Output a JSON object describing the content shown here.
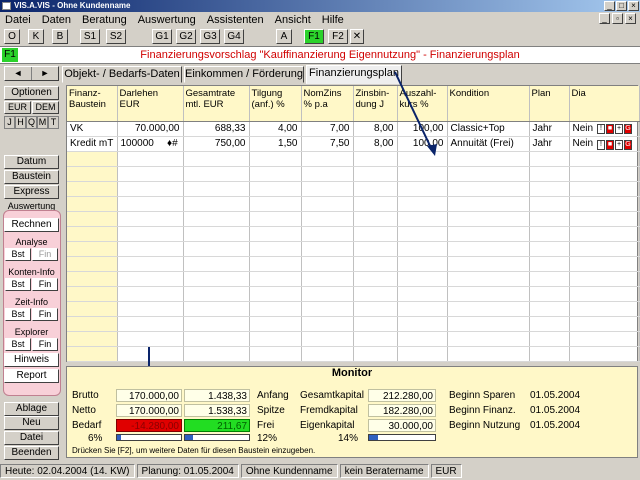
{
  "window": {
    "title": "VIS.A.VIS - Ohne Kundenname"
  },
  "menu": [
    "Datei",
    "Daten",
    "Beratung",
    "Auswertung",
    "Assistenten",
    "Ansicht",
    "Hilfe"
  ],
  "toolbar": {
    "o": "O",
    "k": "K",
    "b": "B",
    "s1": "S1",
    "s2": "S2",
    "g1": "G1",
    "g2": "G2",
    "g3": "G3",
    "g4": "G4",
    "a": "A",
    "f1": "F1",
    "f2": "F2",
    "x": "✕"
  },
  "info": {
    "badge": "F1",
    "text": "Finanzierungsvorschlag \"Kauffinanzierung Eigennutzung\" - Finanzierungsplan"
  },
  "sidebar": {
    "options": "Optionen",
    "eur": "EUR",
    "dem": "DEM",
    "j": "J",
    "h": "H",
    "q": "Q",
    "m": "M",
    "t": "T",
    "datum": "Datum",
    "baustein": "Baustein",
    "express": "Express",
    "auswertung": "Auswertung",
    "rechnen": "Rechnen",
    "analyse": "Analyse",
    "bst": "Bst",
    "fin": "Fin",
    "konteninfo": "Konten-Info",
    "zeitinfo": "Zeit-Info",
    "explorer": "Explorer",
    "hinweis": "Hinweis",
    "report": "Report",
    "ablage": "Ablage",
    "neu": "Neu",
    "datei": "Datei",
    "beenden": "Beenden"
  },
  "tabs": [
    "Objekt- / Bedarfs-Daten",
    "Einkommen / Förderung",
    "Finanzierungsplan"
  ],
  "grid": {
    "headers": [
      "Finanz-\nBaustein",
      "Darlehen\nEUR",
      "Gesamtrate\nmtl. EUR",
      "Tilgung\n(anf.) %",
      "NomZins\n% p.a",
      "Zinsbin-\ndung J",
      "Auszahl-\nkurs %",
      "Kondition",
      "Plan",
      "Dia"
    ],
    "rows": [
      [
        "VK",
        "70.000,00",
        "688,33",
        "4,00",
        "7,00",
        "8,00",
        "100,00",
        "Classic+Top",
        "Jahr",
        "Nein"
      ],
      [
        "Kredit mT",
        "100000",
        "750,00",
        "1,50",
        "7,50",
        "8,00",
        "100,00",
        "Annuität  (Frei)",
        "Jahr",
        "Nein"
      ]
    ],
    "row_markers": [
      "",
      "♦#"
    ],
    "row_buttons": [
      "!",
      "■",
      "+",
      "G"
    ]
  },
  "monitor": {
    "title": "Monitor",
    "brutto": {
      "label": "Brutto",
      "a": "170.000,00",
      "b": "1.438,33"
    },
    "netto": {
      "label": "Netto",
      "a": "170.000,00",
      "b": "1.538,33"
    },
    "bedarf": {
      "label": "Bedarf",
      "a": "-14.280,00",
      "b": "211,67"
    },
    "pct6": "6%",
    "anfang": "Anfang",
    "spitze": "Spitze",
    "frei": "Frei",
    "pct12": "12%",
    "gesamt": {
      "label": "Gesamtkapital",
      "v": "212.280,00"
    },
    "fremd": {
      "label": "Fremdkapital",
      "v": "182.280,00"
    },
    "eigen": {
      "label": "Eigenkapital",
      "v": "30.000,00"
    },
    "pct14": "14%",
    "bsparen": {
      "label": "Beginn Sparen",
      "v": "01.05.2004"
    },
    "bfinanz": {
      "label": "Beginn Finanz.",
      "v": "01.05.2004"
    },
    "bnutzung": {
      "label": "Beginn Nutzung",
      "v": "01.05.2004"
    },
    "hint": "Drücken Sie [F2], um weitere Daten für diesen Baustein einzugeben.",
    "progress": [
      0.06,
      0.12,
      0.14
    ],
    "colors": {
      "bedarf_neg": "#e00000",
      "bedarf_pos": "#22dd22"
    }
  },
  "status": [
    "Heute: 02.04.2004 (14. KW)",
    "Planung: 01.05.2004",
    "Ohne Kundenname",
    "kein Beratername",
    "EUR"
  ]
}
